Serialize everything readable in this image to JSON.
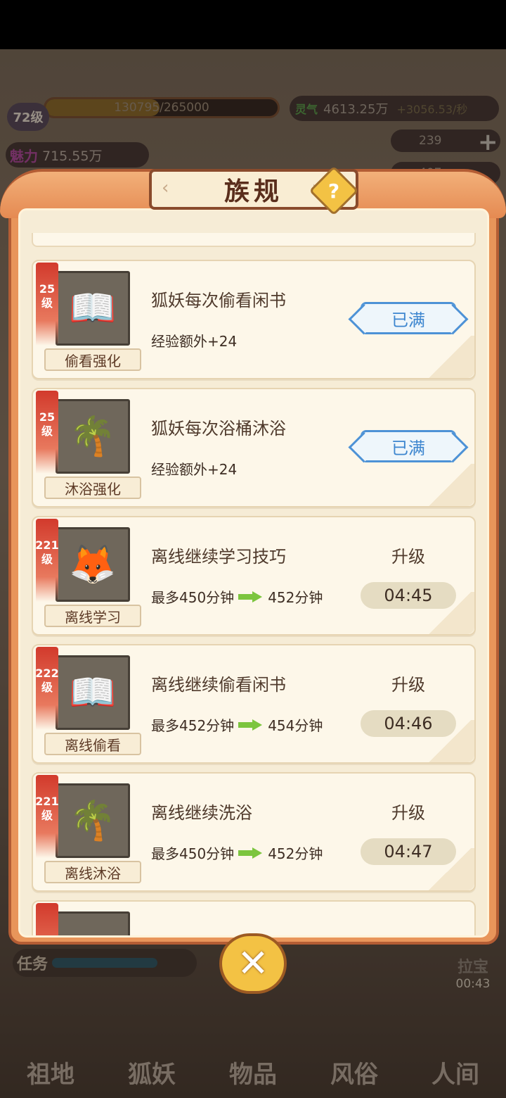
{
  "hud": {
    "level": "72级",
    "exp_text": "130795/265000",
    "exp_progress": 0.49,
    "charm_label": "魅力",
    "charm_value": "715.55万",
    "spirit_label": "灵气",
    "spirit_value": "4613.25万",
    "spirit_rate": "+3056.53/秒",
    "stat1_value": "239",
    "stat2_value": "407"
  },
  "panel": {
    "title": "族规",
    "help_icon": "?",
    "close_icon": "✕"
  },
  "cards": [
    {
      "level_num": "25",
      "level_unit": "级",
      "name": "偷看强化",
      "icon": "book-icon",
      "desc": "狐妖每次偷看闲书",
      "effect": "经验额外+24",
      "status": "已满"
    },
    {
      "level_num": "25",
      "level_unit": "级",
      "name": "沐浴强化",
      "icon": "bath-pool-icon",
      "desc": "狐妖每次浴桶沐浴",
      "effect": "经验额外+24",
      "status": "已满"
    },
    {
      "level_num": "221",
      "level_unit": "级",
      "name": "离线学习",
      "icon": "fox-icon",
      "desc": "离线继续学习技巧",
      "from": "最多450分钟",
      "to": "452分钟",
      "action": "升级",
      "timer": "04:45"
    },
    {
      "level_num": "222",
      "level_unit": "级",
      "name": "离线偷看",
      "icon": "book-icon",
      "desc": "离线继续偷看闲书",
      "from": "最多452分钟",
      "to": "454分钟",
      "action": "升级",
      "timer": "04:46"
    },
    {
      "level_num": "221",
      "level_unit": "级",
      "name": "离线沐浴",
      "icon": "bath-pool-icon",
      "desc": "离线继续洗浴",
      "from": "最多450分钟",
      "to": "452分钟",
      "action": "升级",
      "timer": "04:47"
    }
  ],
  "bottom": {
    "task_label": "任务",
    "shop_label": "拉宝",
    "shop_timer": "00:43",
    "nav": [
      "祖地",
      "狐妖",
      "物品",
      "风俗",
      "人间"
    ]
  }
}
